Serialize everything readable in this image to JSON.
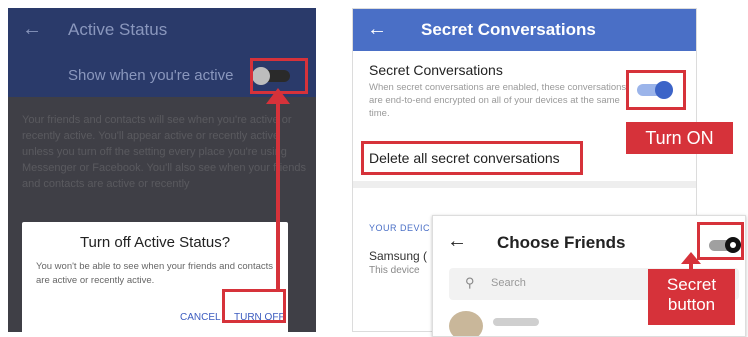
{
  "left": {
    "header_title": "Active Status",
    "back_icon": "arrow-left-icon",
    "show_active_label": "Show when you're active",
    "toggle_state": "off",
    "description": "Your friends and contacts will see when you're active or recently active. You'll appear active or recently active unless you turn off the setting every place you're using Messenger or Facebook. You'll also see when your friends and contacts are active or recently",
    "dialog": {
      "title": "Turn off Active Status?",
      "text": "You won't be able to see when your friends and contacts are active or recently active.",
      "cancel_label": "CANCEL",
      "turn_off_label": "TURN OFF"
    }
  },
  "right": {
    "header_title": "Secret Conversations",
    "back_icon": "arrow-left-icon",
    "sc_title": "Secret Conversations",
    "sc_desc": "When secret conversations are enabled, these conversations are end-to-end encrypted on all of your devices at the same time.",
    "toggle_state": "on",
    "delete_label": "Delete all secret conversations",
    "your_devices_label": "YOUR DEVIC",
    "device_name": "Samsung (",
    "device_sub": "This device"
  },
  "card": {
    "title": "Choose Friends",
    "back_icon": "arrow-left-icon",
    "search_icon": "search-icon",
    "search_placeholder": "Search",
    "toggle_state": "secret"
  },
  "callouts": {
    "turn_on": "Turn ON",
    "secret_button": "Secret\nbutton"
  },
  "colors": {
    "facebook_blue": "#4a6fc6",
    "dim_header": "#2a3a6a",
    "callout_red": "#d6323a"
  }
}
